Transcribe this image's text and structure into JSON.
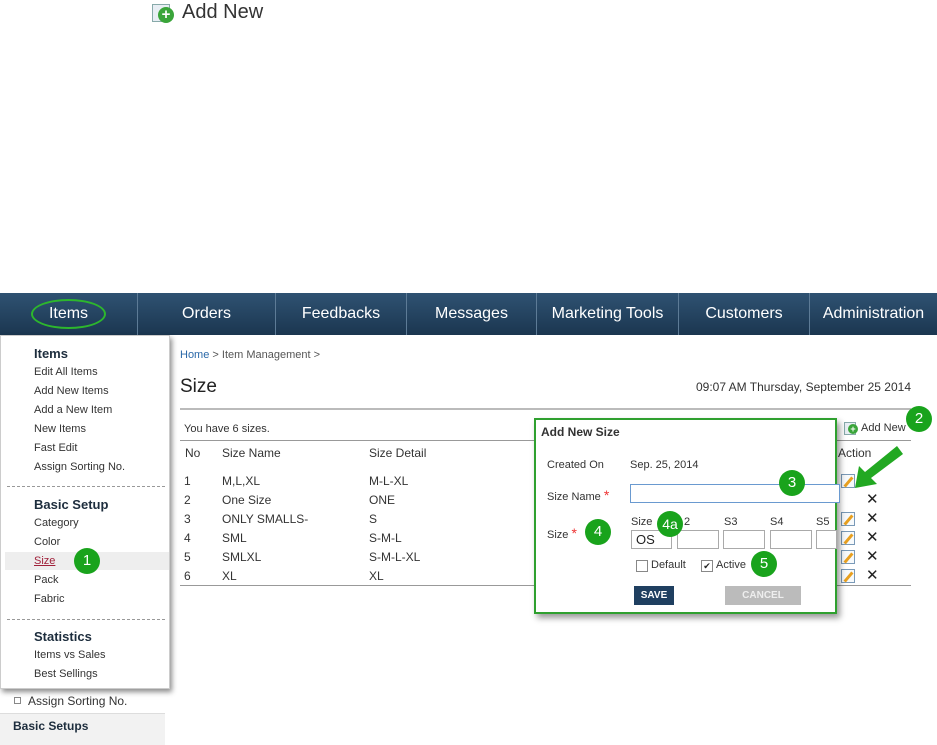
{
  "top_add": {
    "label": "Add New"
  },
  "nav": {
    "items": [
      "Items",
      "Orders",
      "Feedbacks",
      "Messages",
      "Marketing Tools",
      "Customers",
      "Administration"
    ]
  },
  "dropdown": {
    "items_header": "Items",
    "items": [
      "Edit All Items",
      "Add New Items",
      "Add a New Item",
      "New Items",
      "Fast Edit",
      "Assign Sorting No."
    ],
    "basic_header": "Basic Setup",
    "basic": [
      "Category",
      "Color",
      "Size",
      "Pack",
      "Fabric"
    ],
    "stats_header": "Statistics",
    "stats": [
      "Items vs Sales",
      "Best Sellings"
    ]
  },
  "sidebar_under": {
    "assign": "Assign Sorting No.",
    "basic_setups": "Basic Setups"
  },
  "breadcrumb": {
    "home": "Home",
    "sep1": " > ",
    "section": "Item Management",
    "sep2": " >"
  },
  "page": {
    "title": "Size",
    "datetime": "09:07 AM Thursday, September 25 2014",
    "count": "You have 6 sizes.",
    "add_new": "Add New"
  },
  "table": {
    "headers": {
      "no": "No",
      "name": "Size Name",
      "detail": "Size Detail",
      "action": "Action"
    },
    "rows": [
      {
        "no": "1",
        "name": "M,L,XL",
        "detail": "M-L-XL"
      },
      {
        "no": "2",
        "name": "One Size",
        "detail": "ONE"
      },
      {
        "no": "3",
        "name": "ONLY SMALLS-",
        "detail": "S"
      },
      {
        "no": "4",
        "name": "SML",
        "detail": "S-M-L"
      },
      {
        "no": "5",
        "name": "SMLXL",
        "detail": "S-M-L-XL"
      },
      {
        "no": "6",
        "name": "XL",
        "detail": "XL"
      }
    ]
  },
  "modal": {
    "title": "Add New Size",
    "created_label": "Created On",
    "created_value": "Sep. 25, 2014",
    "size_name_label": "Size Name",
    "size_label": "Size",
    "required_mark": "*",
    "size_cols": [
      "Size",
      "2",
      "S3",
      "S4",
      "S5"
    ],
    "size_values": [
      "OS",
      "",
      "",
      "",
      ""
    ],
    "default_label": "Default",
    "active_label": "Active",
    "active_checked": true,
    "default_checked": false,
    "save": "SAVE",
    "cancel": "CANCEL"
  },
  "badges": [
    "1",
    "2",
    "3",
    "4",
    "4a",
    "5"
  ],
  "colors": {
    "nav": "#1b3650",
    "badge": "#19a31c",
    "modal_border": "#2fa02f",
    "save_button": "#1f3f60"
  }
}
